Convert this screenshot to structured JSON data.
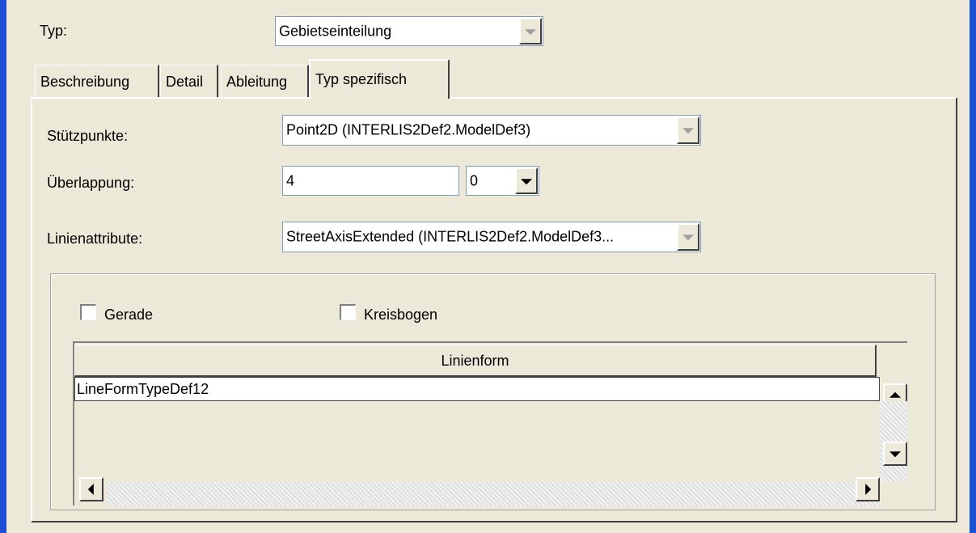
{
  "type_row": {
    "label": "Typ:",
    "value": "Gebietseinteilung"
  },
  "tabs": [
    {
      "label": "Beschreibung",
      "active": false
    },
    {
      "label": "Detail",
      "active": false
    },
    {
      "label": "Ableitung",
      "active": false
    },
    {
      "label": "Typ spezifisch",
      "active": true
    }
  ],
  "fields": {
    "stuetzpunkte": {
      "label": "Stützpunkte:",
      "value": "Point2D (INTERLIS2Def2.ModelDef3)"
    },
    "ueberlappung": {
      "label": "Überlappung:",
      "value": "4",
      "unit_value": "0"
    },
    "linienattribute": {
      "label": "Linienattribute:",
      "value": "StreetAxisExtended (INTERLIS2Def2.ModelDef3..."
    }
  },
  "checkboxes": [
    {
      "label": "Gerade",
      "checked": false
    },
    {
      "label": "Kreisbogen",
      "checked": false
    }
  ],
  "table": {
    "column_header": "Linienform",
    "rows": [
      "LineFormTypeDef12"
    ]
  },
  "colors": {
    "window_bg": "#ece9d8",
    "frame_blue": "#1c4fd4",
    "field_border": "#7f9db9"
  }
}
